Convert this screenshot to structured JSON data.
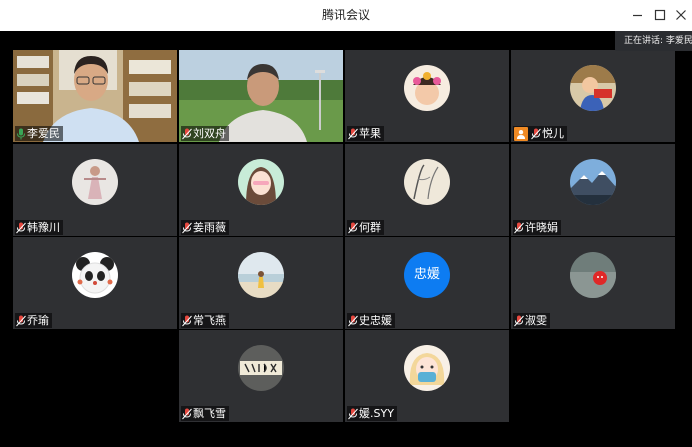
{
  "window": {
    "title": "腾讯会议",
    "speaking_text": "正在讲话: 李爱民;"
  },
  "colors": {
    "tile_bg": "#2f3033",
    "active_outline": "#3aa757",
    "mic_on": "#3aa757",
    "mic_muted": "#e5483f",
    "host_badge": "#f08a24",
    "text_avatar": "#0d7cf2"
  },
  "participants": [
    {
      "name": "李爱民",
      "mic": "on",
      "tile": "video-man-glasses-bookshelf",
      "active": true
    },
    {
      "name": "刘双舟",
      "mic": "muted",
      "tile": "video-man-outdoor-field"
    },
    {
      "name": "苹果",
      "mic": "muted",
      "avatar": "girl-flower-crown-icon"
    },
    {
      "name": "悦儿",
      "mic": "muted",
      "host": true,
      "avatar": "child-red-sign-icon"
    },
    {
      "name": "韩豫川",
      "mic": "muted",
      "avatar": "figure-dancer-icon"
    },
    {
      "name": "姜雨薇",
      "mic": "muted",
      "avatar": "anime-girl-icon"
    },
    {
      "name": "何群",
      "mic": "muted",
      "avatar": "ink-painting-icon"
    },
    {
      "name": "许晓娟",
      "mic": "muted",
      "avatar": "mountain-landscape-icon"
    },
    {
      "name": "乔瑜",
      "mic": "muted",
      "avatar": "panda-icon"
    },
    {
      "name": "常飞燕",
      "mic": "muted",
      "avatar": "beach-person-icon"
    },
    {
      "name": "史忠媛",
      "mic": "muted",
      "avatar_text": "忠媛"
    },
    {
      "name": "淑雯",
      "mic": "muted",
      "avatar": "red-balloon-water-icon"
    },
    {
      "name": "飘飞雪",
      "mic": "muted",
      "avatar": "calligraphy-sign-icon"
    },
    {
      "name": "媛.SYY",
      "mic": "muted",
      "avatar": "anime-blonde-girl-icon"
    }
  ]
}
